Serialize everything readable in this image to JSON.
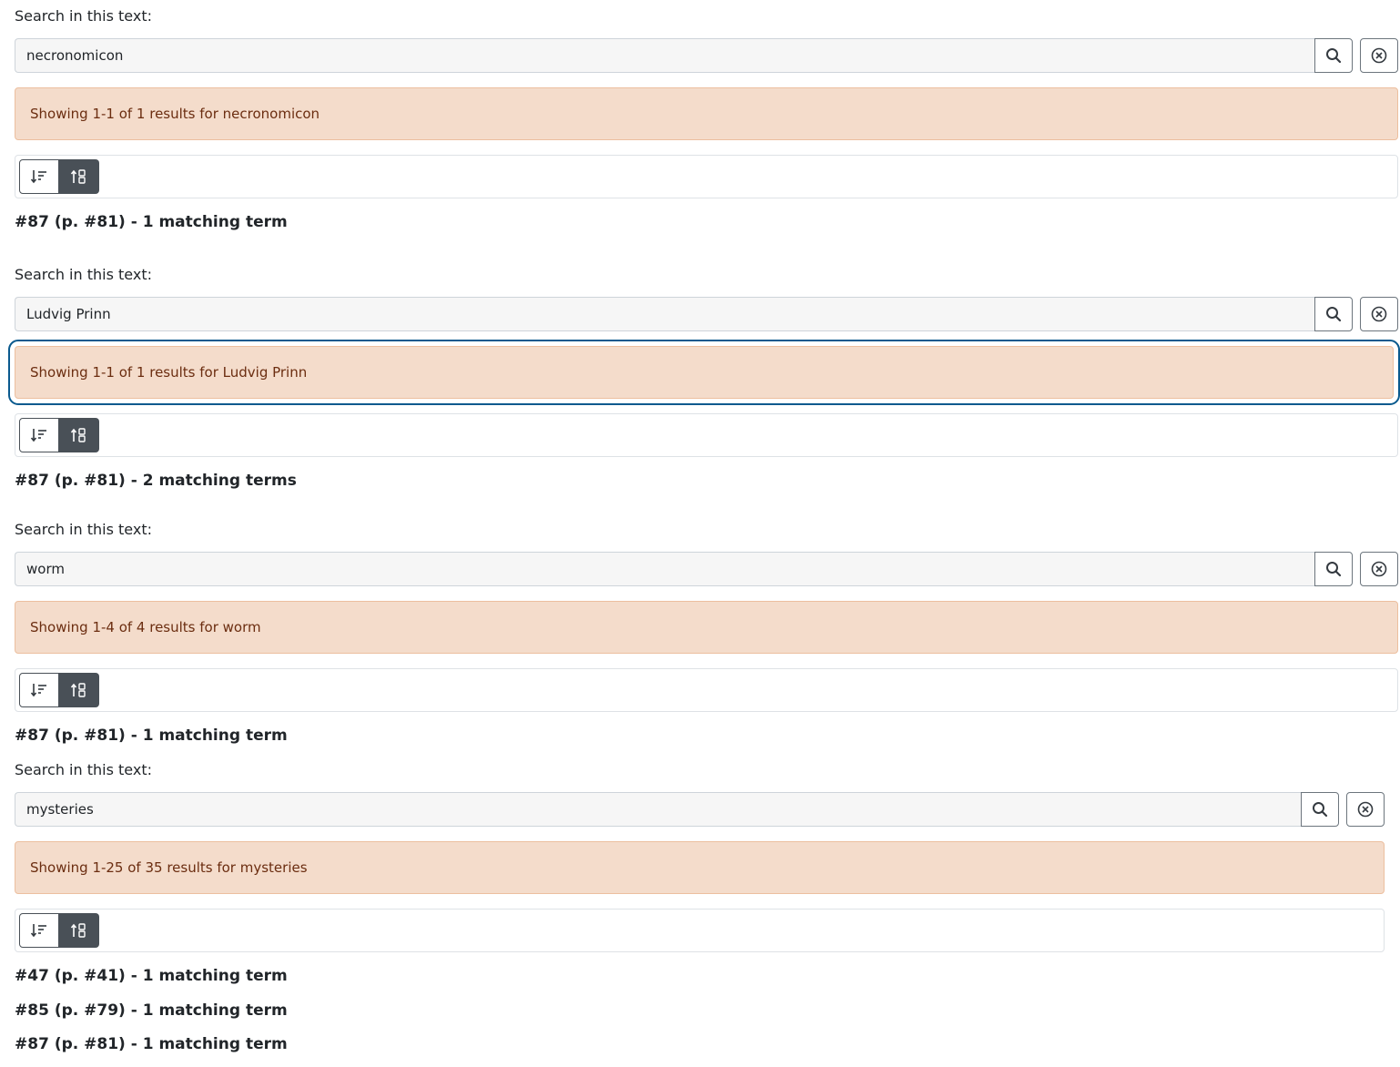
{
  "search_label": "Search in this text:",
  "blocks": [
    {
      "query": "necronomicon",
      "status": "Showing 1-1 of 1 results for necronomicon",
      "results": [
        "#87 (p. #81) - 1 matching term"
      ]
    },
    {
      "query": "Ludvig Prinn",
      "status": "Showing 1-1 of 1 results for Ludvig Prinn",
      "results": [
        "#87 (p. #81) - 2 matching terms"
      ]
    },
    {
      "query": "worm",
      "status": "Showing 1-4 of 4 results for worm",
      "results": [
        "#87 (p. #81) - 1 matching term"
      ]
    },
    {
      "query": "mysteries",
      "status": "Showing 1-25 of 35 results for mysteries",
      "results": [
        "#47 (p. #41) - 1 matching term",
        "#85 (p. #79) - 1 matching term",
        "#87 (p. #81) - 1 matching term"
      ]
    }
  ],
  "icons": {
    "search": "search-icon",
    "clear": "clear-circle-icon",
    "sort_desc": "sort-descending-icon",
    "sort_asc": "sort-ascending-icon"
  },
  "colors": {
    "alert_bg": "#f4dccb",
    "alert_text": "#6b2d10",
    "focus_ring": "#0a5a8e",
    "active_sort": "#495057"
  }
}
